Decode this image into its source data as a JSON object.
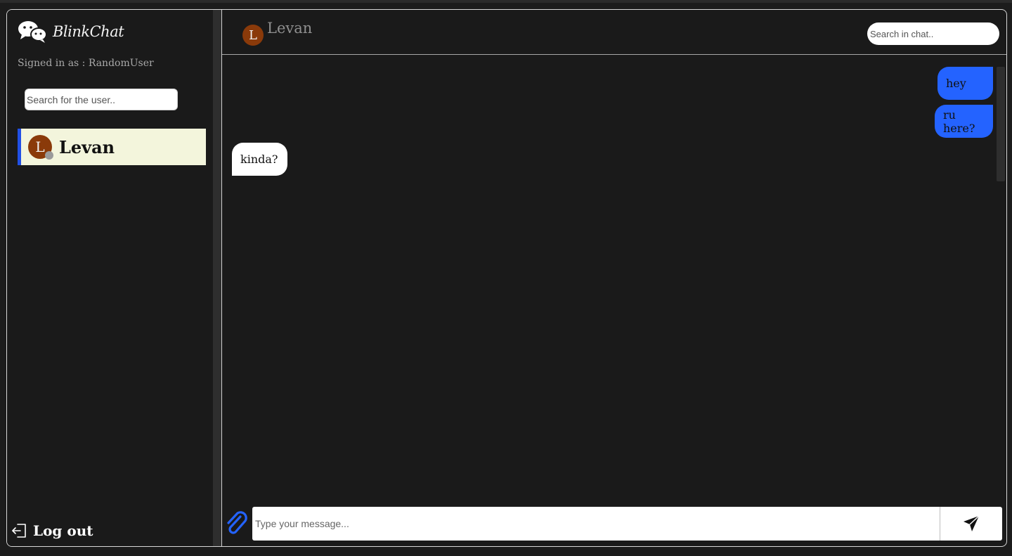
{
  "app": {
    "name": "BlinkChat",
    "logo_icon": "chat-bubbles-icon"
  },
  "sidebar": {
    "signed_in_text": "Signed in as : RandomUser",
    "search_placeholder": "Search for the user..",
    "contacts": [
      {
        "initial": "L",
        "name": "Levan",
        "status": "offline",
        "active": true
      }
    ],
    "logout_label": "Log out",
    "logout_icon": "logout-icon"
  },
  "chat": {
    "header": {
      "avatar_initial": "L",
      "contact_name": "Levan",
      "search_placeholder": "Search in chat.."
    },
    "messages": [
      {
        "text": "hey",
        "direction": "sent"
      },
      {
        "text": "ru here?",
        "direction": "sent"
      },
      {
        "text": "kinda?",
        "direction": "received"
      }
    ],
    "composer": {
      "placeholder": "Type your message...",
      "attach_icon": "paperclip-icon",
      "send_icon": "send-icon"
    }
  },
  "colors": {
    "background": "#1a1a1a",
    "accent": "#2150e6",
    "sent_bubble": "#2463ff",
    "received_bubble": "#ffffff",
    "active_contact_bg": "#f3f5dc",
    "avatar": "#8a3a0a"
  }
}
